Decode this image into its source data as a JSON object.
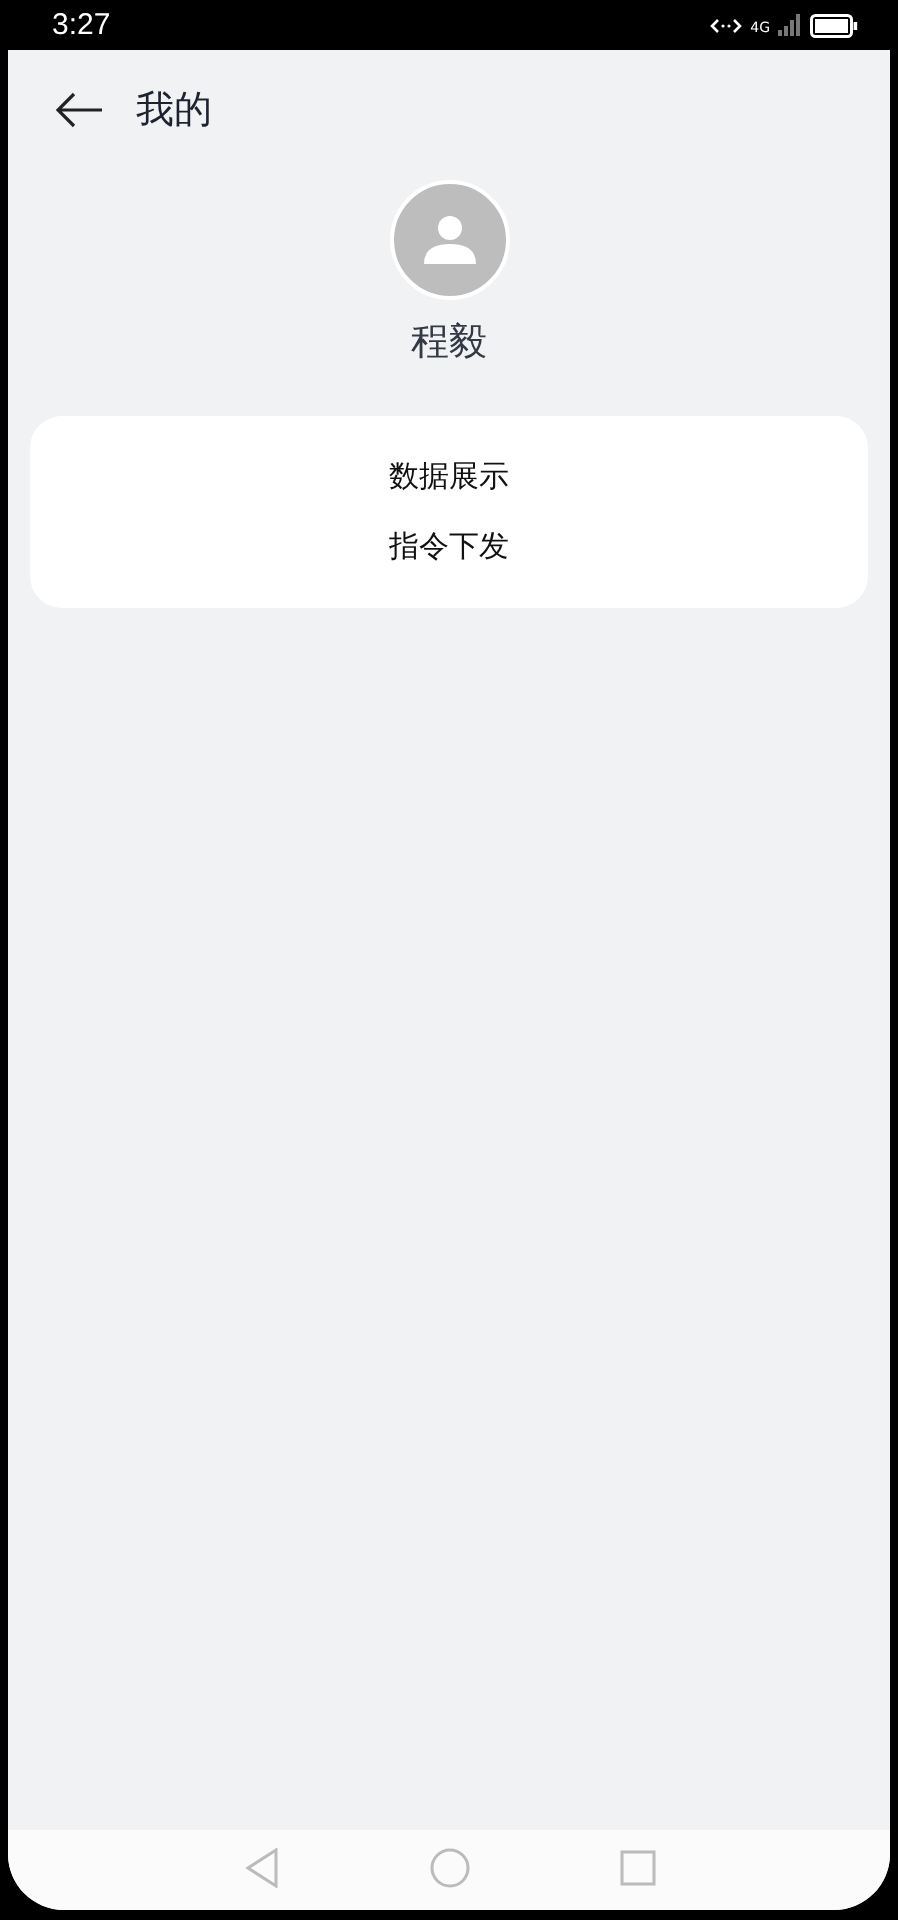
{
  "status_bar": {
    "time": "3:27",
    "network": "4G"
  },
  "header": {
    "title": "我的"
  },
  "profile": {
    "name": "程毅"
  },
  "menu": [
    {
      "label": "数据展示"
    },
    {
      "label": "指令下发"
    }
  ]
}
